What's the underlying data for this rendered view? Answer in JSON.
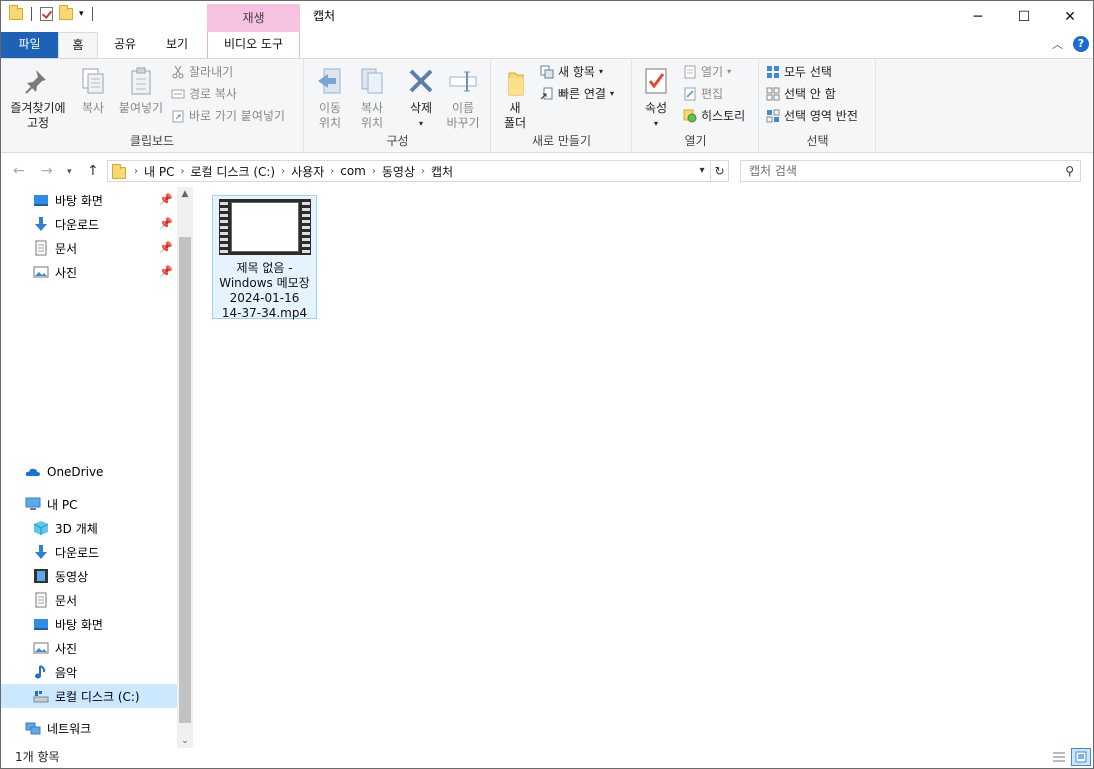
{
  "titlebar": {
    "title": "캡처",
    "context_tab": "재생",
    "controls": [
      "─",
      "☐",
      "✕"
    ]
  },
  "tabs": {
    "file": "파일",
    "home": "홈",
    "share": "공유",
    "view": "보기",
    "video_tools": "비디오 도구"
  },
  "ribbon": {
    "clipboard": {
      "label": "클립보드",
      "pin_quick": "즐겨찾기에\n고정",
      "copy": "복사",
      "paste": "붙여넣기",
      "cut": "잘라내기",
      "copy_path": "경로 복사",
      "paste_shortcut": "바로 가기 붙여넣기"
    },
    "organize": {
      "label": "구성",
      "move_to": "이동\n위치",
      "copy_to": "복사\n위치",
      "delete": "삭제",
      "rename": "이름\n바꾸기"
    },
    "new": {
      "label": "새로 만들기",
      "new_folder": "새\n폴더",
      "new_item": "새 항목",
      "easy_access": "빠른 연결"
    },
    "open": {
      "label": "열기",
      "properties": "속성",
      "open": "열기",
      "edit": "편집",
      "history": "히스토리"
    },
    "select": {
      "label": "선택",
      "select_all": "모두 선택",
      "select_none": "선택 안 함",
      "invert": "선택 영역 반전"
    }
  },
  "address": {
    "crumbs": [
      "내 PC",
      "로컬 디스크 (C:)",
      "사용자",
      "com",
      "동영상",
      "캡처"
    ],
    "search_placeholder": "캡처 검색"
  },
  "navpane": {
    "quick": [
      {
        "label": "바탕 화면",
        "icon": "desktop-icon"
      },
      {
        "label": "다운로드",
        "icon": "download-icon"
      },
      {
        "label": "문서",
        "icon": "document-icon"
      },
      {
        "label": "사진",
        "icon": "pictures-icon"
      }
    ],
    "onedrive": "OneDrive",
    "this_pc": "내 PC",
    "pc_items": [
      {
        "label": "3D 개체",
        "icon": "3d-objects-icon"
      },
      {
        "label": "다운로드",
        "icon": "download-icon"
      },
      {
        "label": "동영상",
        "icon": "videos-icon"
      },
      {
        "label": "문서",
        "icon": "document-icon"
      },
      {
        "label": "바탕 화면",
        "icon": "desktop-icon"
      },
      {
        "label": "사진",
        "icon": "pictures-icon"
      },
      {
        "label": "음악",
        "icon": "music-icon"
      },
      {
        "label": "로컬 디스크 (C:)",
        "icon": "drive-icon"
      }
    ],
    "network": "네트워크"
  },
  "files": [
    {
      "name_lines": [
        "제목 없음 -",
        "Windows 메모장",
        "2024-01-16",
        "14-37-34.mp4"
      ]
    }
  ],
  "status": {
    "count": "1개 항목"
  },
  "colors": {
    "file_tab": "#1d62b7",
    "context_tab": "#f7c2e0",
    "selection": "#cce8ff"
  }
}
